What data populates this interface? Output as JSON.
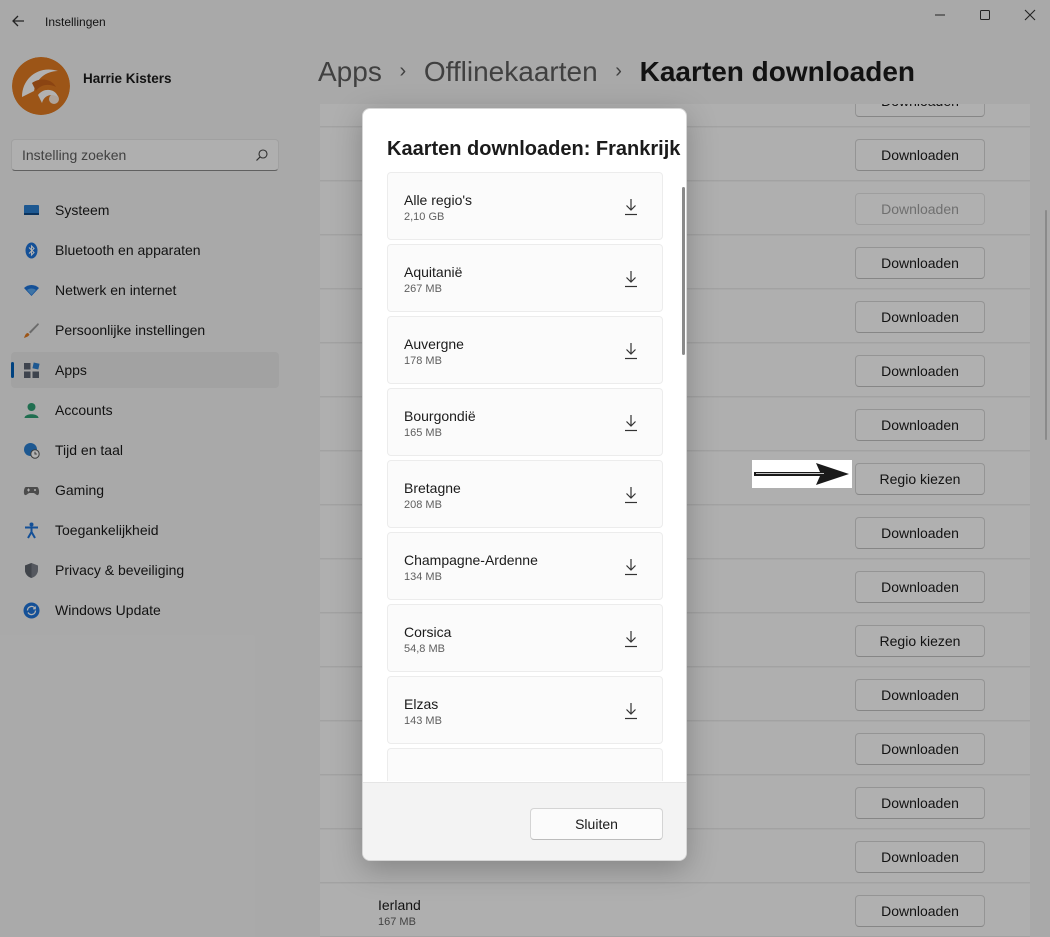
{
  "window": {
    "title": "Instellingen",
    "controls": [
      "minimize-icon",
      "maximize-icon",
      "close-icon"
    ]
  },
  "profile": {
    "name": "Harrie Kisters",
    "avatar_colors": [
      "#e07a22",
      "#ffffff"
    ]
  },
  "search": {
    "placeholder": "Instelling zoeken"
  },
  "sidebar": {
    "items": [
      {
        "label": "Systeem",
        "icon": "system-icon",
        "active": false
      },
      {
        "label": "Bluetooth en apparaten",
        "icon": "bluetooth-icon",
        "active": false
      },
      {
        "label": "Netwerk en internet",
        "icon": "wifi-icon",
        "active": false
      },
      {
        "label": "Persoonlijke instellingen",
        "icon": "brush-icon",
        "active": false
      },
      {
        "label": "Apps",
        "icon": "apps-icon",
        "active": true
      },
      {
        "label": "Accounts",
        "icon": "person-icon",
        "active": false
      },
      {
        "label": "Tijd en taal",
        "icon": "globe-clock-icon",
        "active": false
      },
      {
        "label": "Gaming",
        "icon": "gamepad-icon",
        "active": false
      },
      {
        "label": "Toegankelijkheid",
        "icon": "accessibility-icon",
        "active": false
      },
      {
        "label": "Privacy & beveiliging",
        "icon": "shield-icon",
        "active": false
      },
      {
        "label": "Windows Update",
        "icon": "update-icon",
        "active": false
      }
    ]
  },
  "breadcrumb": {
    "items": [
      "Apps",
      "Offlinekaarten",
      "Kaarten downloaden"
    ],
    "separator": "›"
  },
  "list": {
    "rows": [
      {
        "name": "",
        "size": "",
        "button": "Downloaden",
        "disabled": false
      },
      {
        "name": "",
        "size": "",
        "button": "Downloaden",
        "disabled": false
      },
      {
        "name": "",
        "size": "",
        "button": "Downloaden",
        "disabled": true
      },
      {
        "name": "",
        "size": "",
        "button": "Downloaden",
        "disabled": false
      },
      {
        "name": "",
        "size": "",
        "button": "Downloaden",
        "disabled": false
      },
      {
        "name": "",
        "size": "",
        "button": "Downloaden",
        "disabled": false
      },
      {
        "name": "",
        "size": "",
        "button": "Downloaden",
        "disabled": false
      },
      {
        "name": "",
        "size": "",
        "button": "Regio kiezen",
        "disabled": false
      },
      {
        "name": "",
        "size": "",
        "button": "Downloaden",
        "disabled": false
      },
      {
        "name": "",
        "size": "",
        "button": "Downloaden",
        "disabled": false
      },
      {
        "name": "",
        "size": "",
        "button": "Regio kiezen",
        "disabled": false
      },
      {
        "name": "",
        "size": "",
        "button": "Downloaden",
        "disabled": false
      },
      {
        "name": "",
        "size": "",
        "button": "Downloaden",
        "disabled": false
      },
      {
        "name": "",
        "size": "",
        "button": "Downloaden",
        "disabled": false
      },
      {
        "name": "",
        "size": "",
        "button": "Downloaden",
        "disabled": false
      },
      {
        "name": "Ierland",
        "size": "167 MB",
        "button": "Downloaden",
        "disabled": false
      }
    ]
  },
  "dialog": {
    "title": "Kaarten downloaden: Frankrijk",
    "regions": [
      {
        "name": "Alle regio's",
        "size": "2,10 GB"
      },
      {
        "name": "Aquitanië",
        "size": "267 MB"
      },
      {
        "name": "Auvergne",
        "size": "178 MB"
      },
      {
        "name": "Bourgondië",
        "size": "165 MB"
      },
      {
        "name": "Bretagne",
        "size": "208 MB"
      },
      {
        "name": "Champagne-Ardenne",
        "size": "134 MB"
      },
      {
        "name": "Corsica",
        "size": "54,8 MB"
      },
      {
        "name": "Elzas",
        "size": "143 MB"
      },
      {
        "name": "",
        "size": ""
      }
    ],
    "close_label": "Sluiten"
  },
  "colors": {
    "accent": "#005fb8",
    "overlay": "rgba(0,0,0,0.30)"
  }
}
